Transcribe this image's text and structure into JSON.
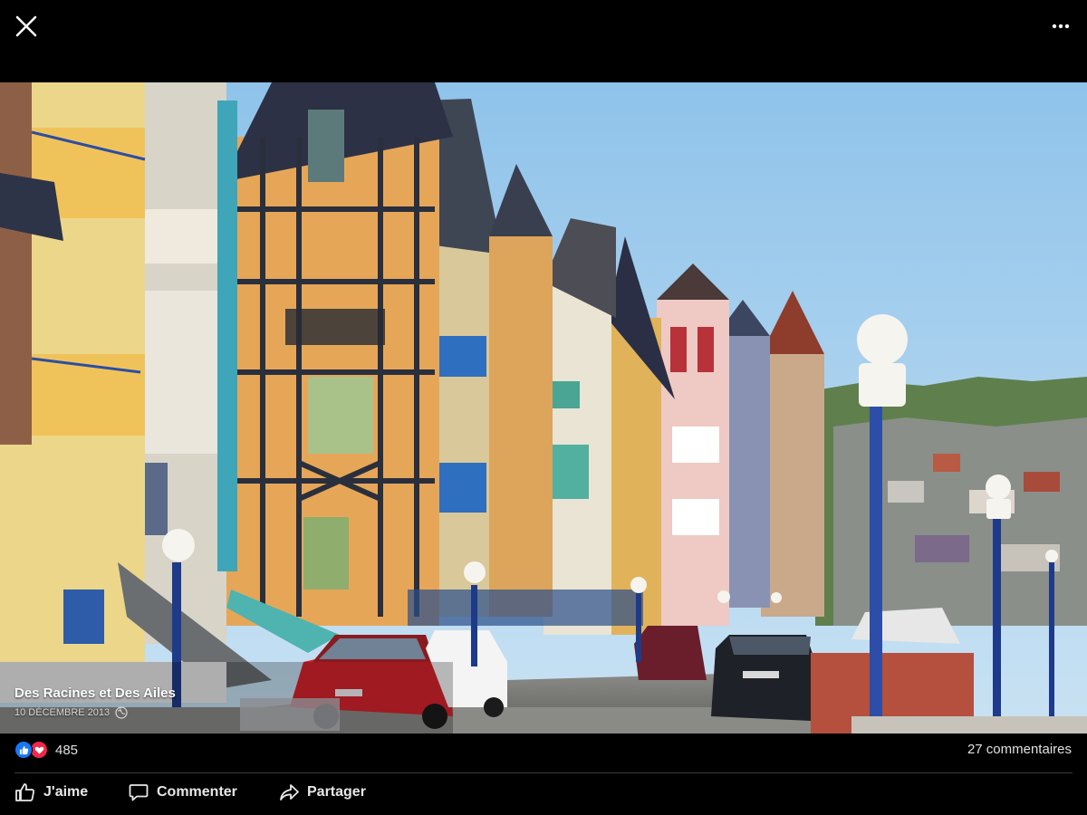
{
  "post": {
    "author": "Des Racines et Des Ailes",
    "date": "10 DÉCEMBRE 2013"
  },
  "stats": {
    "reaction_count": "485",
    "comments": "27 commentaires"
  },
  "actions": {
    "like": "J'aime",
    "comment": "Commenter",
    "share": "Partager"
  },
  "icons": {
    "close": "close-icon",
    "more": "more-icon",
    "globe": "globe-icon",
    "like_reaction": "like-reaction-icon",
    "love_reaction": "love-reaction-icon",
    "thumbs_up": "thumbs-up-icon",
    "comment": "comment-icon",
    "share": "share-icon"
  },
  "colors": {
    "background": "#000000",
    "like_blue": "#1877f2",
    "love_red": "#f0284a",
    "text": "#e8e8e8"
  }
}
